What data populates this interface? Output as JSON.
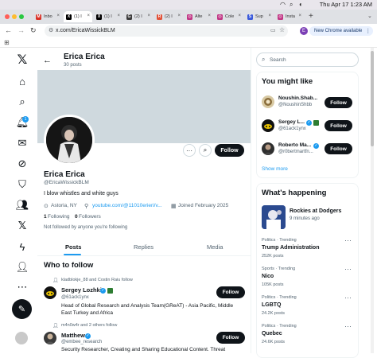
{
  "menubar": {
    "clock": "Thu Apr 17  1:23 AM"
  },
  "browser": {
    "tabs": [
      {
        "label": "Inbo",
        "color": "#d93025",
        "glyph": "M"
      },
      {
        "label": "(1) I",
        "color": "#000000",
        "glyph": "X"
      },
      {
        "label": "(1) I",
        "color": "#000000",
        "glyph": "X"
      },
      {
        "label": "(2) I",
        "color": "#3c3c3c",
        "glyph": "G"
      },
      {
        "label": "(2) I",
        "color": "#e2533a",
        "glyph": "R"
      },
      {
        "label": "Alte",
        "color": "#c13584",
        "glyph": "◎"
      },
      {
        "label": "Cole",
        "color": "#c13584",
        "glyph": "◎"
      },
      {
        "label": "Sup",
        "color": "#3b5bdb",
        "glyph": "S"
      },
      {
        "label": "Insta",
        "color": "#c13584",
        "glyph": "◎"
      }
    ],
    "url": "x.com/EricaWissickBLM",
    "new_chrome": "New Chrome available",
    "profile_initial": "E"
  },
  "nav": {
    "notification_count": "1"
  },
  "profile": {
    "header_name": "Erica Erica",
    "post_count": "30 posts",
    "name": "Erica Erica",
    "handle": "@EricaWissickBLM",
    "bio": "I blow whistles and white guys",
    "location": "Astoria, NY",
    "website": "youtube.com/@11010erieri/v...",
    "joined": "Joined February 2025",
    "following_count": "1",
    "following_label": "Following",
    "followers_count": "0",
    "followers_label": "Followers",
    "not_followed": "Not followed by anyone you're following",
    "follow_label": "Follow",
    "more_dots": "···"
  },
  "tabs": [
    "Posts",
    "Replies",
    "Media"
  ],
  "who_to_follow": {
    "title": "Who to follow",
    "items": [
      {
        "context": "kladblokje_88 and Costin Raiu follow",
        "name": "Sergey Lozhkin",
        "handle": "@61ack1ynx",
        "bio": "Head of Global Research and Analysis Team(GReAT) - Asia Pacific, Middle East Turkey and Africa",
        "follow": "Follow"
      },
      {
        "context": "m4n0w4r and 2 others follow",
        "name": "Matthew",
        "handle": "@embee_research",
        "bio": "Security Researcher, Creating and Sharing Educational Content. Threat",
        "follow": "Follow"
      }
    ]
  },
  "search": {
    "placeholder": "Search"
  },
  "you_might_like": {
    "title": "You might like",
    "items": [
      {
        "name": "Noushin.Shab...",
        "handle": "@NoushinShbb",
        "follow": "Follow"
      },
      {
        "name": "Sergey L...",
        "handle": "@61ack1ynx",
        "follow": "Follow"
      },
      {
        "name": "Roberto Ma...",
        "handle": "@r0bertmartfn...",
        "follow": "Follow"
      }
    ],
    "show_more": "Show more"
  },
  "whats_happening": {
    "title": "What's happening",
    "event": {
      "title": "Rockies at Dodgers",
      "meta": "9 minutes ago"
    },
    "trends": [
      {
        "category": "Politics · Trending",
        "name": "Trump Administration",
        "count": "252K posts"
      },
      {
        "category": "Sports · Trending",
        "name": "Nico",
        "count": "105K posts"
      },
      {
        "category": "Politics · Trending",
        "name": "LGBTQ",
        "count": "24.2K posts"
      },
      {
        "category": "Politics · Trending",
        "name": "Quebec",
        "count": "24.6K posts"
      }
    ]
  }
}
